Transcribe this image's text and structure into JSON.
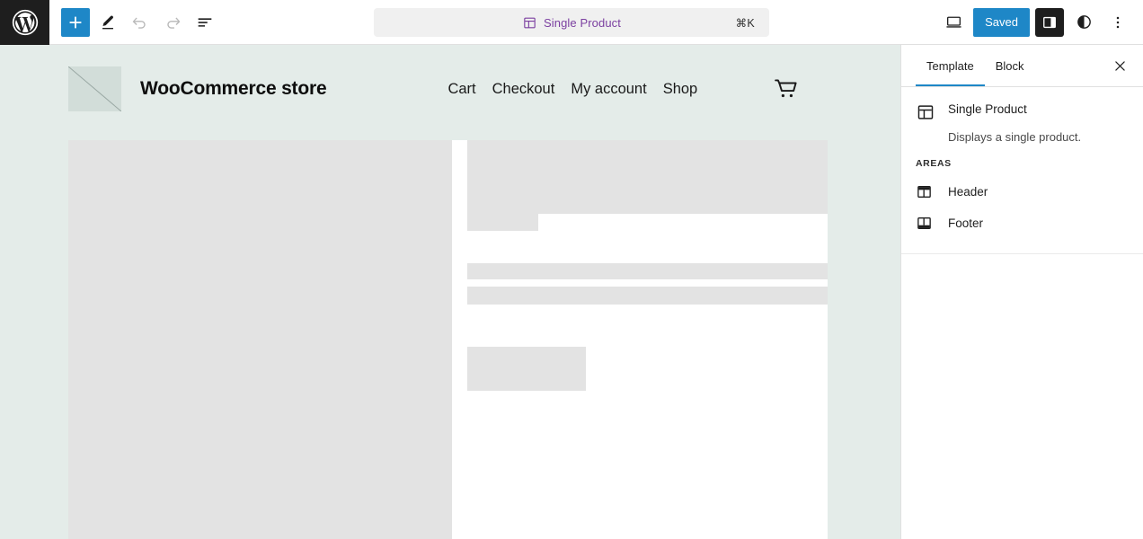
{
  "topbar": {
    "logo_icon": "wordpress-logo-icon",
    "tools": [
      {
        "name": "add-block-button",
        "icon": "plus-icon",
        "state": "primary"
      },
      {
        "name": "edit-tool-button",
        "icon": "pencil-icon",
        "state": "default"
      },
      {
        "name": "undo-button",
        "icon": "undo-arrow-icon",
        "state": "disabled"
      },
      {
        "name": "redo-button",
        "icon": "redo-arrow-icon",
        "state": "disabled"
      },
      {
        "name": "document-overview-button",
        "icon": "list-view-icon",
        "state": "default"
      }
    ],
    "command_bar": {
      "icon": "template-layout-icon",
      "title": "Single Product",
      "shortcut": "⌘K"
    },
    "right": {
      "view_icon": "desktop-preview-icon",
      "save_label": "Saved",
      "settings_toggle_icon": "sidebar-toggle-icon",
      "styles_icon": "styles-contrast-icon",
      "more_icon": "more-options-icon"
    }
  },
  "canvas": {
    "site_title": "WooCommerce store",
    "logo_icon": "site-logo-placeholder-icon",
    "nav": [
      {
        "label": "Cart"
      },
      {
        "label": "Checkout"
      },
      {
        "label": "My account"
      },
      {
        "label": "Shop"
      }
    ],
    "cart_icon": "shopping-cart-icon"
  },
  "sidebar": {
    "tabs": [
      {
        "label": "Template",
        "active": true
      },
      {
        "label": "Block",
        "active": false
      }
    ],
    "close_icon": "close-icon",
    "template": {
      "icon": "template-layout-icon",
      "name": "Single Product",
      "description": "Displays a single product."
    },
    "areas_label": "AREAS",
    "areas": [
      {
        "label": "Header",
        "icon": "header-area-icon"
      },
      {
        "label": "Footer",
        "icon": "footer-area-icon"
      }
    ]
  },
  "colors": {
    "accent_blue": "#1e87c7",
    "command_purple": "#7b3fa0",
    "canvas_bg": "#e4ece9",
    "skeleton_gray": "#e3e3e3",
    "toolbar_dark": "#1e1e1e"
  }
}
